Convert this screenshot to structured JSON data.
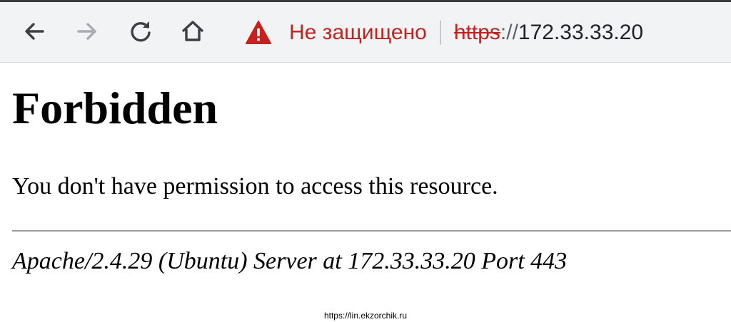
{
  "browser": {
    "nav_icons": {
      "back": "arrow-left-icon",
      "forward": "arrow-right-icon",
      "reload": "reload-icon",
      "home": "home-icon"
    },
    "security": {
      "icon": "warning-triangle-icon",
      "label": "Не защищено"
    },
    "address": {
      "scheme": "https",
      "separator": "://",
      "host": "172.33.33.20"
    }
  },
  "page": {
    "title": "Forbidden",
    "message": "You don't have permission to access this resource.",
    "signature": "Apache/2.4.29 (Ubuntu) Server at 172.33.33.20 Port 443"
  },
  "watermark": "https://lin.ekzorchik.ru",
  "colors": {
    "toolbar_bg": "#f1f3f4",
    "insecure_red": "#c5221f",
    "icon_gray": "#3c4043",
    "icon_disabled": "#a8abad"
  }
}
